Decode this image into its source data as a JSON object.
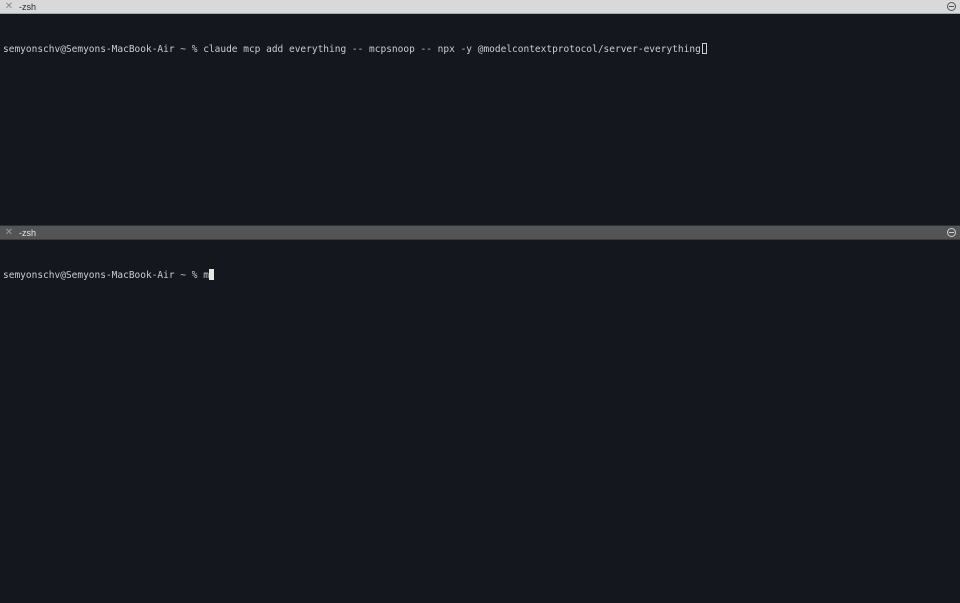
{
  "panes": {
    "top": {
      "tab_title": "-zsh",
      "close_icon": "close-icon",
      "minimize_icon": "minimize-icon",
      "prompt": "semyonschv@Semyons-MacBook-Air ~ % ",
      "command": "claude mcp add everything -- mcpsnoop -- npx -y @modelcontextprotocol/server-everything",
      "focused": false
    },
    "bottom": {
      "tab_title": "-zsh",
      "close_icon": "close-icon",
      "minimize_icon": "minimize-icon",
      "prompt": "semyonschv@Semyons-MacBook-Air ~ % ",
      "command": "m",
      "focused": true
    }
  },
  "colors": {
    "background": "#14171d",
    "text": "#c9ccd3",
    "active_tabbar": "#545454",
    "inactive_tabbar": "#d9d9d9"
  }
}
